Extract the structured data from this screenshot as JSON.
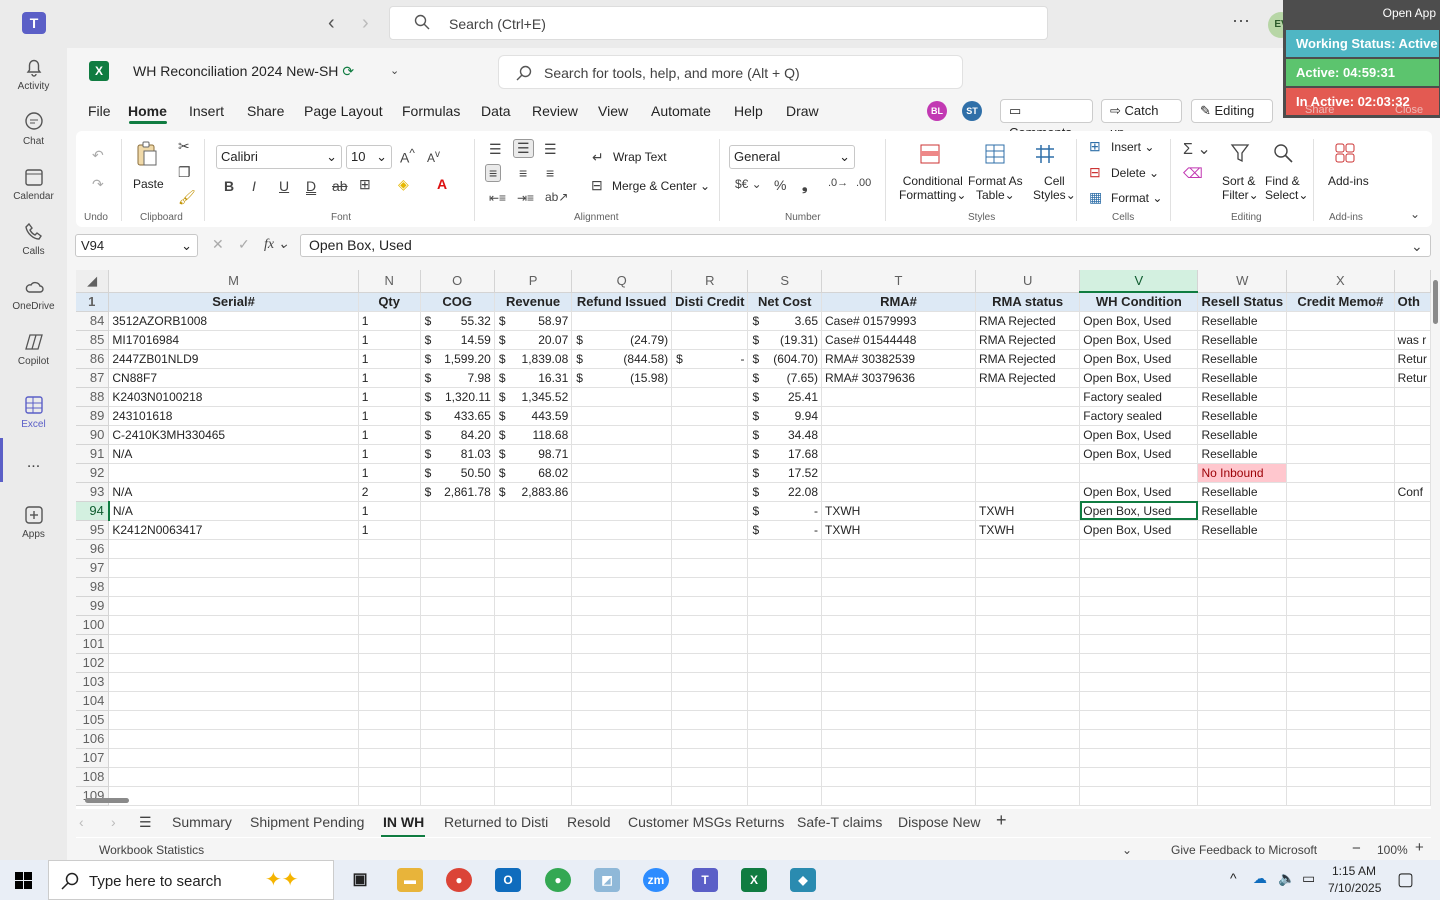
{
  "teams": {
    "search_placeholder": "Search (Ctrl+E)",
    "avatar": "EV",
    "rail": [
      {
        "label": "Activity",
        "icon": "bell-icon"
      },
      {
        "label": "Chat",
        "icon": "chat-icon"
      },
      {
        "label": "Calendar",
        "icon": "calendar-icon"
      },
      {
        "label": "Calls",
        "icon": "phone-icon"
      },
      {
        "label": "OneDrive",
        "icon": "cloud-icon"
      },
      {
        "label": "Copilot",
        "icon": "copilot-icon"
      },
      {
        "label": "Excel",
        "icon": "excel-icon"
      },
      {
        "label": "...",
        "icon": "more-icon"
      },
      {
        "label": "Apps",
        "icon": "plus-box-icon"
      }
    ]
  },
  "excel": {
    "doc_title": "WH Reconciliation 2024 New-SH",
    "tool_search": "Search for tools, help, and more (Alt + Q)",
    "menu": [
      "File",
      "Home",
      "Insert",
      "Share",
      "Page Layout",
      "Formulas",
      "Data",
      "Review",
      "View",
      "Automate",
      "Help",
      "Draw"
    ],
    "presence": [
      "BL",
      "ST"
    ],
    "comments": "Comments",
    "catchup": "Catch up",
    "editing": "Editing",
    "share": "Share",
    "close": "Close",
    "ribbon": {
      "undo": "Undo",
      "paste": "Paste",
      "clipboard": "Clipboard",
      "font_name": "Calibri",
      "font_size": "10",
      "font": "Font",
      "wrap_text": "Wrap Text",
      "merge_center": "Merge & Center",
      "alignment": "Alignment",
      "number_format": "General",
      "number": "Number",
      "conditional_formatting": [
        "Conditional",
        "Formatting"
      ],
      "format_as_table": [
        "Format As",
        "Table"
      ],
      "cell_styles": [
        "Cell",
        "Styles"
      ],
      "styles": "Styles",
      "insert": "Insert",
      "delete": "Delete",
      "format": "Format",
      "cells": "Cells",
      "sort_filter": [
        "Sort &",
        "Filter"
      ],
      "find_select": [
        "Find &",
        "Select"
      ],
      "editing": "Editing",
      "addins": "Add-ins",
      "addins_group": "Add-ins"
    },
    "name_box": "V94",
    "formula": "Open Box, Used",
    "columns": [
      "M",
      "N",
      "O",
      "P",
      "Q",
      "R",
      "S",
      "T",
      "U",
      "V",
      "W",
      "X",
      ""
    ],
    "header_row": {
      "num": "1",
      "cells": [
        "Serial#",
        "Qty",
        "COG",
        "Revenue",
        "Refund Issued",
        "Disti Credit",
        "Net Cost",
        "RMA#",
        "RMA status",
        "WH Condition",
        "Resell Status",
        "Credit Memo#",
        "Oth"
      ]
    },
    "rows": [
      {
        "num": "84",
        "serial": "3512AZORB1008",
        "qty": "1",
        "cog": "55.32",
        "rev": "58.97",
        "refund": "",
        "disti": "",
        "net": "3.65",
        "rma": "Case# 01579993",
        "rma_status": "RMA Rejected",
        "cond": "Open Box, Used",
        "resell": "Resellable",
        "credit": "",
        "other": ""
      },
      {
        "num": "85",
        "serial": "MI17016984",
        "qty": "1",
        "cog": "14.59",
        "rev": "20.07",
        "refund": "(24.79)",
        "disti": "",
        "net": "(19.31)",
        "rma": "Case# 01544448",
        "rma_status": "RMA Rejected",
        "cond": "Open Box, Used",
        "resell": "Resellable",
        "credit": "",
        "other": "was r"
      },
      {
        "num": "86",
        "serial": "2447ZB01NLD9",
        "qty": "1",
        "cog": "1,599.20",
        "rev": "1,839.08",
        "refund": "(844.58)",
        "disti": "-",
        "net": "(604.70)",
        "rma": "RMA# 30382539",
        "rma_status": "RMA Rejected",
        "cond": "Open Box, Used",
        "resell": "Resellable",
        "credit": "",
        "other": "Retur"
      },
      {
        "num": "87",
        "serial": "CN88F7",
        "qty": "1",
        "cog": "7.98",
        "rev": "16.31",
        "refund": "(15.98)",
        "disti": "",
        "net": "(7.65)",
        "rma": "RMA# 30379636",
        "rma_status": "RMA Rejected",
        "cond": "Open Box, Used",
        "resell": "Resellable",
        "credit": "",
        "other": "Retur"
      },
      {
        "num": "88",
        "serial": "K2403N0100218",
        "qty": "1",
        "cog": "1,320.11",
        "rev": "1,345.52",
        "refund": "",
        "disti": "",
        "net": "25.41",
        "rma": "",
        "rma_status": "",
        "cond": "Factory sealed",
        "resell": "Resellable",
        "credit": "",
        "other": ""
      },
      {
        "num": "89",
        "serial": "243101618",
        "qty": "1",
        "cog": "433.65",
        "rev": "443.59",
        "refund": "",
        "disti": "",
        "net": "9.94",
        "rma": "",
        "rma_status": "",
        "cond": "Factory sealed",
        "resell": "Resellable",
        "credit": "",
        "other": ""
      },
      {
        "num": "90",
        "serial": "C-2410K3MH330465",
        "qty": "1",
        "cog": "84.20",
        "rev": "118.68",
        "refund": "",
        "disti": "",
        "net": "34.48",
        "rma": "",
        "rma_status": "",
        "cond": "Open Box, Used",
        "resell": "Resellable",
        "credit": "",
        "other": ""
      },
      {
        "num": "91",
        "serial": "N/A",
        "qty": "1",
        "cog": "81.03",
        "rev": "98.71",
        "refund": "",
        "disti": "",
        "net": "17.68",
        "rma": "",
        "rma_status": "",
        "cond": "Open Box, Used",
        "resell": "Resellable",
        "credit": "",
        "other": ""
      },
      {
        "num": "92",
        "serial": "",
        "qty": "1",
        "cog": "50.50",
        "rev": "68.02",
        "refund": "",
        "disti": "",
        "net": "17.52",
        "rma": "",
        "rma_status": "",
        "cond": "",
        "resell": "No Inbound",
        "credit": "",
        "other": ""
      },
      {
        "num": "93",
        "serial": "N/A",
        "qty": "2",
        "cog": "2,861.78",
        "rev": "2,883.86",
        "refund": "",
        "disti": "",
        "net": "22.08",
        "rma": "",
        "rma_status": "",
        "cond": "Open Box, Used",
        "resell": "Resellable",
        "credit": "",
        "other": "Conf"
      },
      {
        "num": "94",
        "serial": "N/A",
        "qty": "1",
        "cog": "",
        "rev": "",
        "refund": "",
        "disti": "",
        "net": "-",
        "rma": "TXWH",
        "rma_status": "TXWH",
        "cond": "Open Box, Used",
        "resell": "Resellable",
        "credit": "",
        "other": ""
      },
      {
        "num": "95",
        "serial": "K2412N0063417",
        "qty": "1",
        "cog": "",
        "rev": "",
        "refund": "",
        "disti": "",
        "net": "-",
        "rma": "TXWH",
        "rma_status": "TXWH",
        "cond": "Open Box, Used",
        "resell": "Resellable",
        "credit": "",
        "other": ""
      }
    ],
    "empty_rows": [
      "96",
      "97",
      "98",
      "99",
      "100",
      "101",
      "102",
      "103",
      "104",
      "105",
      "106",
      "107",
      "108",
      "109"
    ],
    "dollar": "$",
    "sheet_tabs": [
      "Summary",
      "Shipment Pending",
      "IN WH",
      "Returned to Disti",
      "Resold",
      "Customer MSGs Returns",
      "Safe-T claims",
      "Dispose New"
    ],
    "status_left": "Workbook Statistics",
    "feedback": "Give Feedback to Microsoft",
    "zoom": "100%"
  },
  "overlay": {
    "open_app": "Open App",
    "working": "Working Status: Active",
    "active": "Active: 04:59:31",
    "inactive": "In Active: 02:03:32",
    "colors": {
      "working": "#4fb6c4",
      "active": "#5cc46e",
      "inactive": "#e35a52"
    }
  },
  "taskbar": {
    "search": "Type here to search",
    "time": "1:15 AM",
    "date": "7/10/2025"
  }
}
